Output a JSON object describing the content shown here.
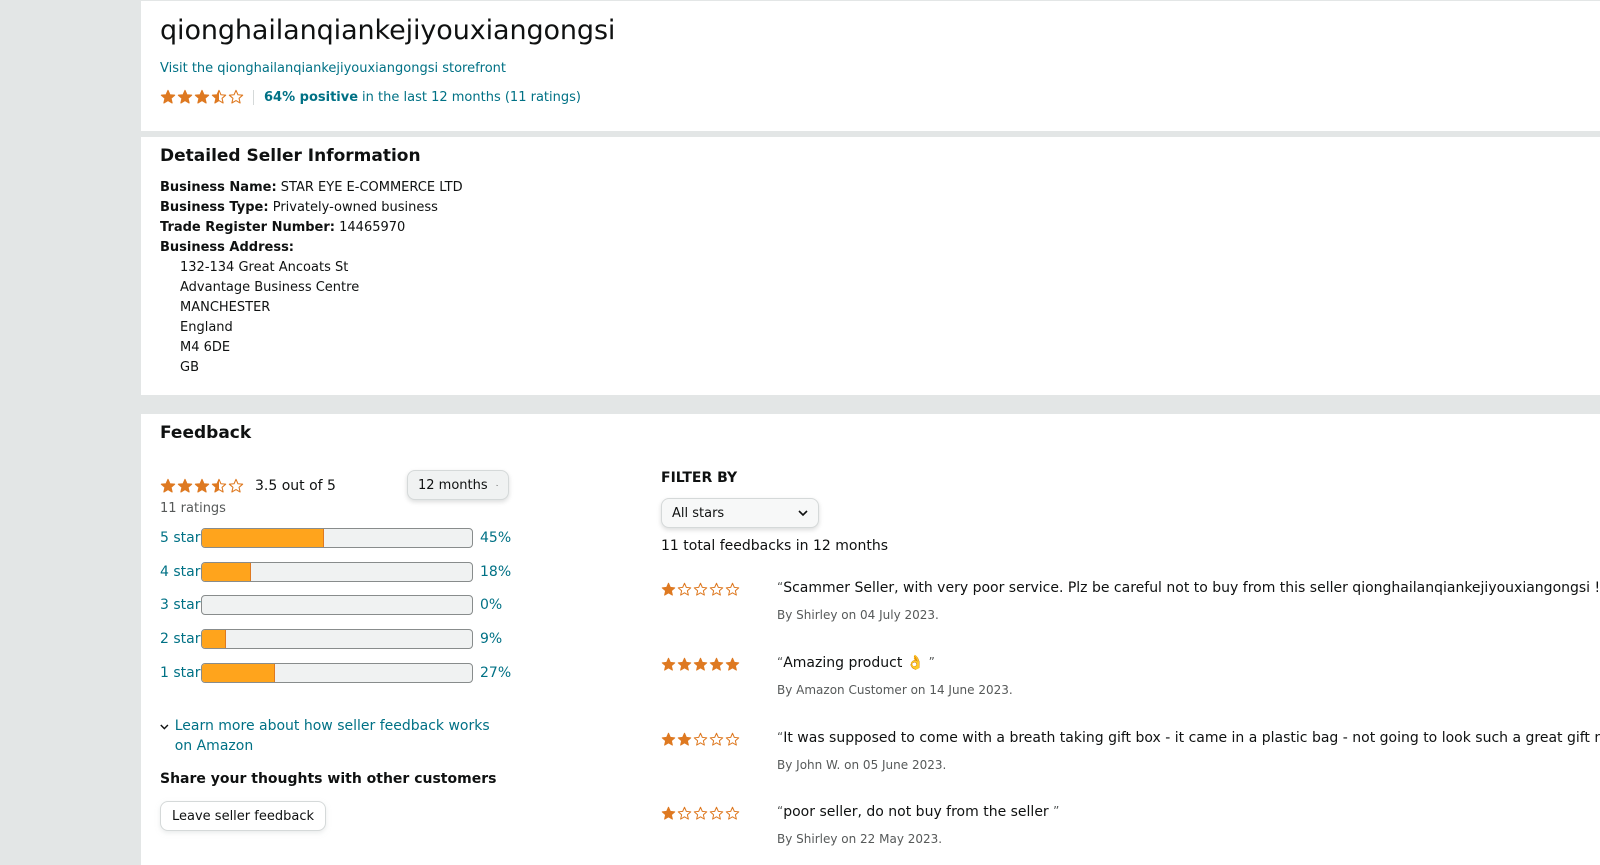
{
  "colors": {
    "star": "#de7921",
    "bar_fill": "#ffa41c",
    "link": "#007185"
  },
  "seller": {
    "name": "qionghailanqiankejiyouxiangongsi",
    "storefront_link": "Visit the qionghailanqiankejiyouxiangongsi storefront",
    "rating_stars": 3.5,
    "positive": "64% positive",
    "positive_rest": "in the last 12 months (11 ratings)"
  },
  "details": {
    "title": "Detailed Seller Information",
    "business_name_label": "Business Name:",
    "business_name": "STAR EYE E-COMMERCE LTD",
    "business_type_label": "Business Type:",
    "business_type": "Privately-owned business",
    "trade_register_label": "Trade Register Number:",
    "trade_register": "14465970",
    "address_label": "Business Address:",
    "address": [
      "132-134 Great Ancoats St",
      "Advantage Business Centre",
      "MANCHESTER",
      "England",
      "M4 6DE",
      "GB"
    ]
  },
  "feedback": {
    "title": "Feedback",
    "rating_stars": 3.5,
    "rating_text": "3.5 out of  5",
    "count_text": "11 ratings",
    "period_select": "12 months",
    "histogram": [
      {
        "label": "5 star",
        "percent": 45,
        "percent_text": "45%"
      },
      {
        "label": "4 star",
        "percent": 18,
        "percent_text": "18%"
      },
      {
        "label": "3 star",
        "percent": 0,
        "percent_text": "0%"
      },
      {
        "label": "2 star",
        "percent": 9,
        "percent_text": "9%"
      },
      {
        "label": "1 star",
        "percent": 27,
        "percent_text": "27%"
      }
    ],
    "learn_more": "Learn more about how seller feedback works on Amazon",
    "share_title": "Share your thoughts with other customers",
    "leave_button": "Leave seller feedback",
    "filter_title": "FILTER BY",
    "filter_select": "All stars",
    "total_text": "11 total feedbacks in 12 months",
    "reviews": [
      {
        "stars": 1,
        "text": "Scammer Seller, with very poor service. Plz be careful not to buy from this seller qionghailanqiankejiyouxiangongsi !!! ",
        "by": "By Shirley on 04 July 2023."
      },
      {
        "stars": 5,
        "text": "Amazing product 👌 ",
        "by": "By Amazon Customer on 14 June 2023."
      },
      {
        "stars": 2,
        "text": "It was supposed to come with a breath taking gift box - it came in a plastic bag - not going to look such a great gift now! ",
        "by": "By John W. on 05 June 2023."
      },
      {
        "stars": 1,
        "text": "poor seller, do not buy from the seller ",
        "by": "By Shirley on 22 May 2023."
      }
    ]
  }
}
